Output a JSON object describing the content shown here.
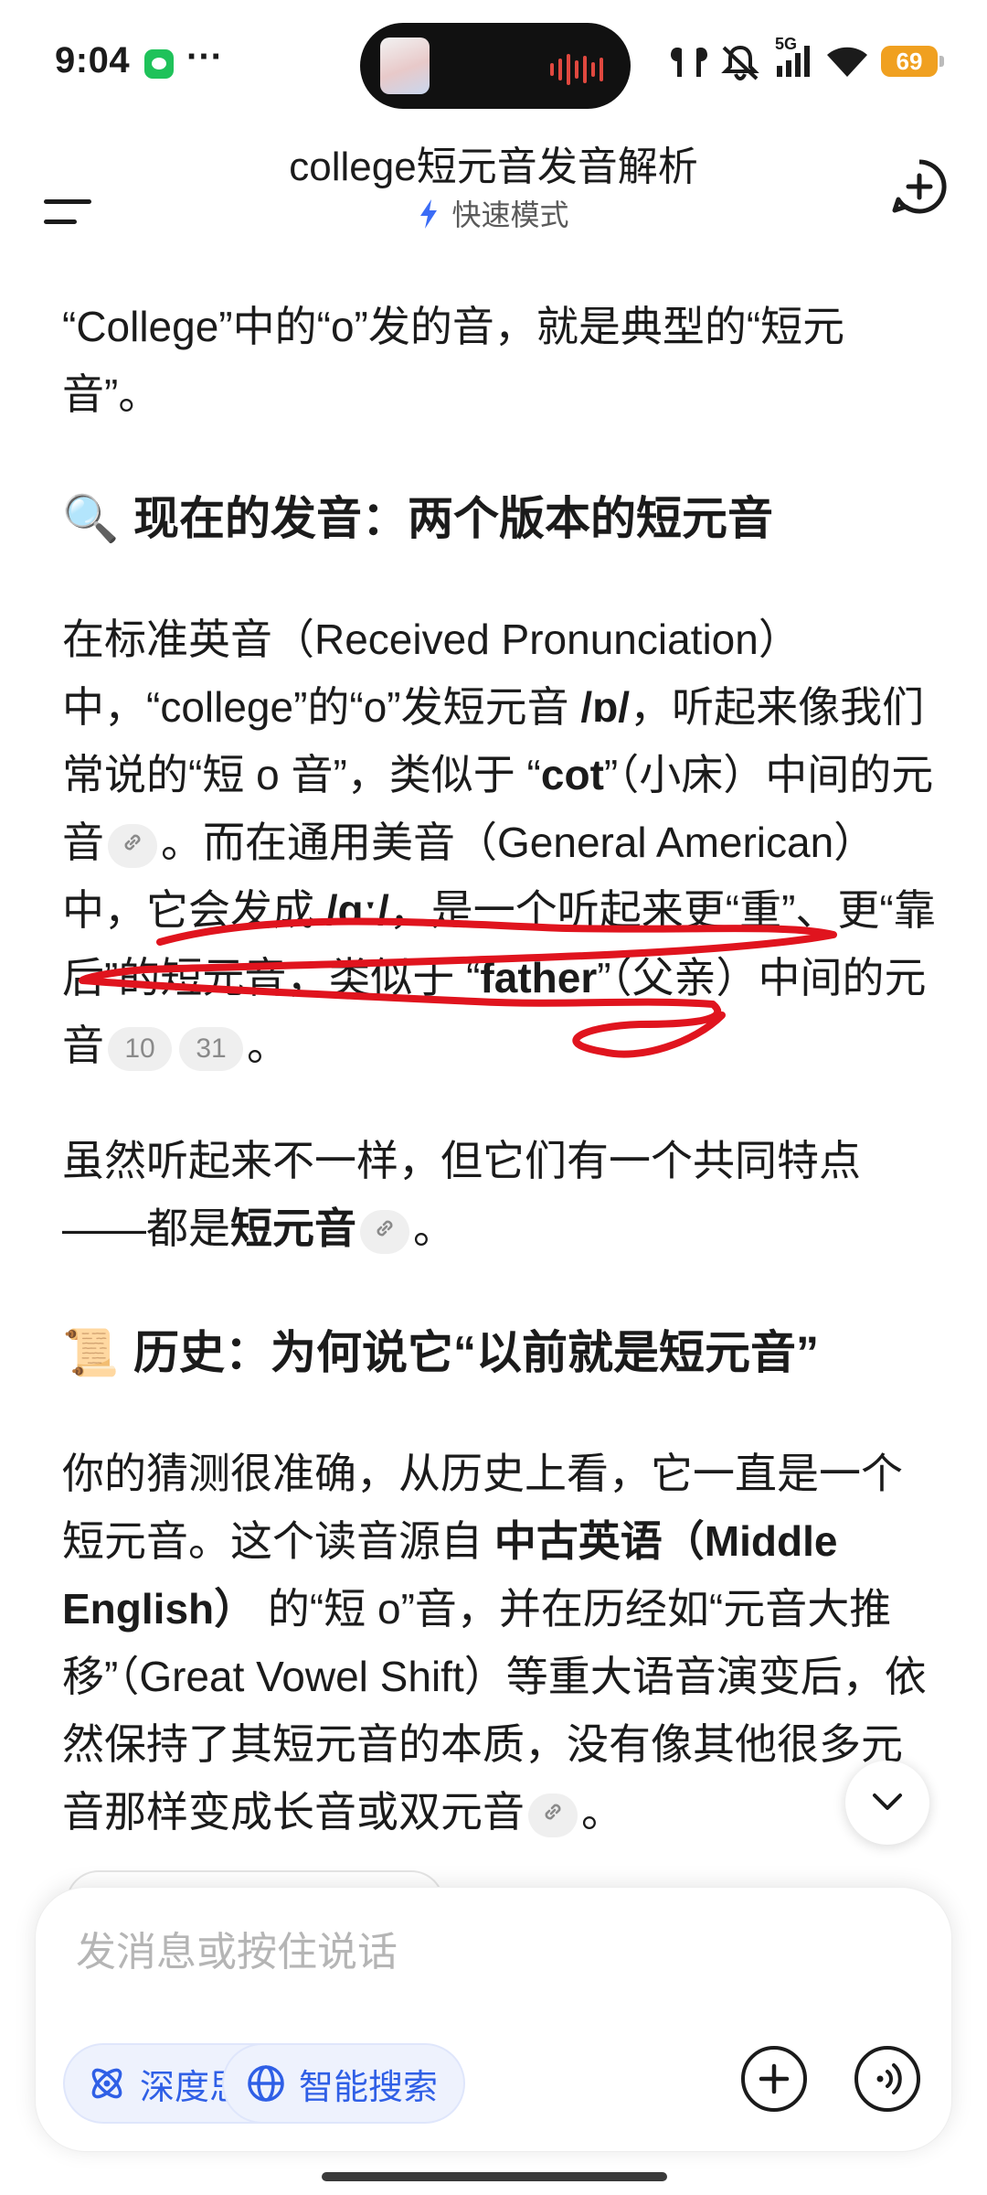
{
  "status_bar": {
    "time": "9:04",
    "signal": "5G",
    "battery": "69",
    "colors": {
      "battery": "#f0a020",
      "wechat": "#1fc25a"
    },
    "icons": [
      "wechat-icon",
      "more-icon",
      "earbuds-icon",
      "mute-icon",
      "signal-icon",
      "wifi-icon",
      "battery-icon"
    ]
  },
  "header": {
    "title": "college短元音发音解析",
    "mode": "快速模式",
    "icons": [
      "menu-icon",
      "lightning-icon",
      "new-chat-icon"
    ]
  },
  "content": {
    "p1": "“College”中的“o”发的音，就是典型的“短元音”。",
    "h2_1": "现在的发音：两个版本的短元音",
    "h2_1_emoji": "🔍",
    "p2": {
      "a": "在标准英音（Received Pronunciation）中，“college”的“o”发短元音 ",
      "b": "/ɒ/",
      "c": "，听起来像我们常说的“短 o 音”，类似于 “",
      "d": "cot",
      "e": "”（小床）中间的元音",
      "f": "。而在通用美音（General American）中，它会发成 ",
      "g": "/ɑː/",
      "h": "，是一个听起来更“重”、更“靠后”的短元音，类似于 “",
      "i": "father",
      "j": "”（父亲）中间的元音",
      "cite1": "10",
      "cite2": "31",
      "k": "。"
    },
    "p3": {
      "a": "虽然听起来不一样，但它们有一个共同特点——都是",
      "b": "短元音",
      "c": "。"
    },
    "h2_2": "历史：为何说它“以前就是短元音”",
    "h2_2_emoji": "📜",
    "p4": {
      "a": "你的猜测很准确，从历史上看，它一直是一个短元音。这个读音源自 ",
      "b": "中古英语（Middle English）",
      "c": " 的“短 o”音，并在历经如“元音大推移”（Great Vowel Shift）等重大语音演变后，依然保持了其短元音的本质，没有像其他很多元音那样变成长音或双元音",
      "d": "。"
    },
    "annotation_color": "#e0141e"
  },
  "composer": {
    "placeholder": "发消息或按住说话",
    "chip_deep": "深度思考",
    "chip_search": "智能搜索",
    "accent": "#2f5fe6",
    "icons": [
      "atom-icon",
      "globe-icon",
      "plus-icon",
      "voice-icon",
      "chevron-down-icon"
    ]
  }
}
